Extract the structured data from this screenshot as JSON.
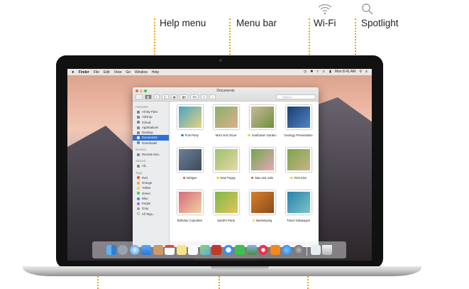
{
  "callouts": {
    "help_menu": "Help menu",
    "menu_bar": "Menu bar",
    "wifi": "Wi-Fi",
    "spotlight": "Spotlight"
  },
  "menubar": {
    "apple": "",
    "app_name": "Finder",
    "items": [
      "File",
      "Edit",
      "View",
      "Go",
      "Window",
      "Help"
    ],
    "time": "Mon 8:41 AM"
  },
  "finder": {
    "title": "Documents",
    "search_placeholder": "Search",
    "sidebar": {
      "favorites_header": "Favorites",
      "favorites": [
        "All My Files",
        "AirDrop",
        "iCloud",
        "Applications",
        "Desktop",
        "Documents",
        "Downloads"
      ],
      "devices_header": "Devices",
      "devices": [
        "Remote Disc"
      ],
      "shared_header": "Shared",
      "shared": [
        "All..."
      ],
      "tags_header": "Tags",
      "tags": [
        {
          "name": "Red",
          "color": "#e94b3c"
        },
        {
          "name": "Orange",
          "color": "#f5a623"
        },
        {
          "name": "Yellow",
          "color": "#f4d03f"
        },
        {
          "name": "Green",
          "color": "#5cb85c"
        },
        {
          "name": "Blue",
          "color": "#3a86e0"
        },
        {
          "name": "Purple",
          "color": "#a06cd5"
        },
        {
          "name": "Gray",
          "color": "#999999"
        },
        {
          "name": "All Tags...",
          "color": ""
        }
      ]
    },
    "files": [
      {
        "name": "Pool Party",
        "tag": "#3a86e0"
      },
      {
        "name": "Mom and Oscar",
        "tag": ""
      },
      {
        "name": "Southtown Garden",
        "tag": "#f4d03f"
      },
      {
        "name": "Geology Presentation",
        "tag": ""
      },
      {
        "name": "Bridges",
        "tag": "#e94b3c"
      },
      {
        "name": "New Puppy",
        "tag": "#f4d03f"
      },
      {
        "name": "Max and Julie",
        "tag": "#e94b3c"
      },
      {
        "name": "First Kiss",
        "tag": "#f4d03f"
      },
      {
        "name": "Birthday Cupcakes",
        "tag": ""
      },
      {
        "name": "Sarah's Party",
        "tag": ""
      },
      {
        "name": "Beekeeping",
        "tag": "#f4d03f"
      },
      {
        "name": "Travel Galapagos",
        "tag": ""
      }
    ]
  },
  "colors": {
    "accent": "#f0a500",
    "selection": "#2b6fd8"
  }
}
